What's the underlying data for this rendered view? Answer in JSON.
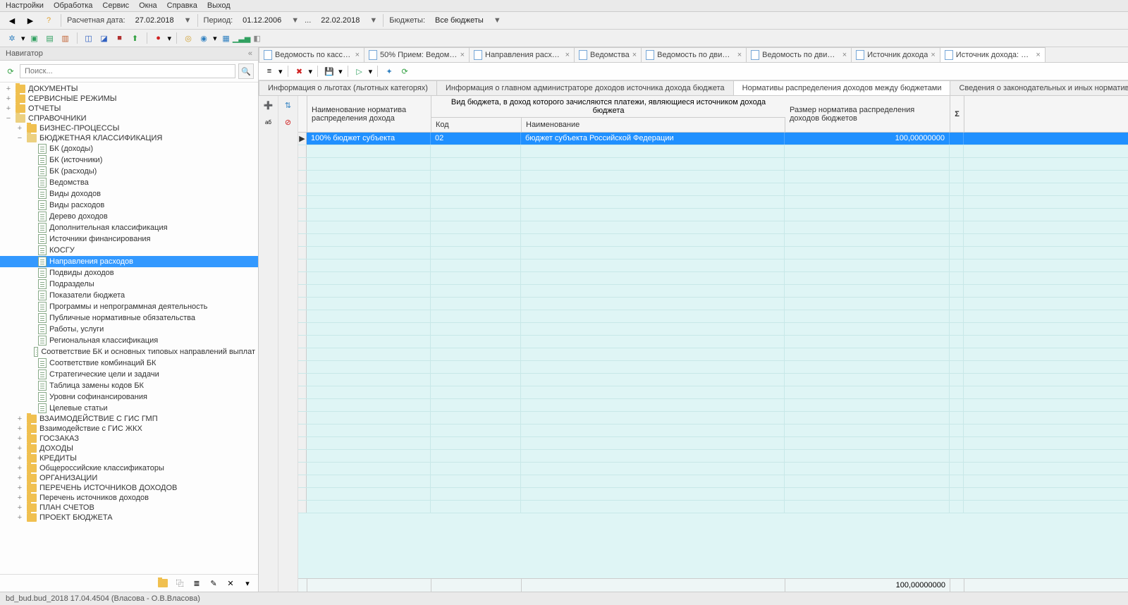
{
  "menu": [
    "Настройки",
    "Обработка",
    "Сервис",
    "Окна",
    "Справка",
    "Выход"
  ],
  "toolbar1": {
    "date_label": "Расчетная дата:",
    "date_value": "27.02.2018",
    "period_label": "Период:",
    "period_from": "01.12.2006",
    "period_to": "22.02.2018",
    "period_sep": "...",
    "budget_label": "Бюджеты:",
    "budget_value": "Все бюджеты"
  },
  "navigator": {
    "title": "Навигатор",
    "collapse": "«",
    "search_placeholder": "Поиск...",
    "tree": [
      {
        "level": 0,
        "type": "folder",
        "open": false,
        "exp": "+",
        "label": "ДОКУМЕНТЫ"
      },
      {
        "level": 0,
        "type": "folder",
        "open": false,
        "exp": "+",
        "label": "СЕРВИСНЫЕ РЕЖИМЫ"
      },
      {
        "level": 0,
        "type": "folder",
        "open": false,
        "exp": "+",
        "label": "ОТЧЕТЫ"
      },
      {
        "level": 0,
        "type": "folder",
        "open": true,
        "exp": "−",
        "label": "СПРАВОЧНИКИ"
      },
      {
        "level": 1,
        "type": "folder",
        "open": false,
        "exp": "+",
        "label": "БИЗНЕС-ПРОЦЕССЫ"
      },
      {
        "level": 1,
        "type": "folder",
        "open": true,
        "exp": "−",
        "label": "БЮДЖЕТНАЯ КЛАССИФИКАЦИЯ"
      },
      {
        "level": 2,
        "type": "doc",
        "label": "БК (доходы)"
      },
      {
        "level": 2,
        "type": "doc",
        "label": "БК (источники)"
      },
      {
        "level": 2,
        "type": "doc",
        "label": "БК (расходы)"
      },
      {
        "level": 2,
        "type": "doc",
        "label": "Ведомства"
      },
      {
        "level": 2,
        "type": "doc",
        "label": "Виды доходов"
      },
      {
        "level": 2,
        "type": "doc",
        "label": "Виды расходов"
      },
      {
        "level": 2,
        "type": "doc",
        "label": "Дерево доходов"
      },
      {
        "level": 2,
        "type": "doc",
        "label": "Дополнительная классификация"
      },
      {
        "level": 2,
        "type": "doc",
        "label": "Источники финансирования"
      },
      {
        "level": 2,
        "type": "doc",
        "label": "КОСГУ"
      },
      {
        "level": 2,
        "type": "doc",
        "label": "Направления расходов",
        "selected": true
      },
      {
        "level": 2,
        "type": "doc",
        "label": "Подвиды доходов"
      },
      {
        "level": 2,
        "type": "doc",
        "label": "Подразделы"
      },
      {
        "level": 2,
        "type": "doc",
        "label": "Показатели бюджета"
      },
      {
        "level": 2,
        "type": "doc",
        "label": "Программы и непрограммная деятельность"
      },
      {
        "level": 2,
        "type": "doc",
        "label": "Публичные нормативные обязательства"
      },
      {
        "level": 2,
        "type": "doc",
        "label": "Работы, услуги"
      },
      {
        "level": 2,
        "type": "doc",
        "label": "Региональная классификация"
      },
      {
        "level": 2,
        "type": "doc",
        "label": "Соответствие БК и основных типовых направлений выплат"
      },
      {
        "level": 2,
        "type": "doc",
        "label": "Соответствие комбинаций БК"
      },
      {
        "level": 2,
        "type": "doc",
        "label": "Стратегические цели и задачи"
      },
      {
        "level": 2,
        "type": "doc",
        "label": "Таблица замены кодов БК"
      },
      {
        "level": 2,
        "type": "doc",
        "label": "Уровни софинансирования"
      },
      {
        "level": 2,
        "type": "doc",
        "label": "Целевые статьи"
      },
      {
        "level": 1,
        "type": "folder",
        "open": false,
        "exp": "+",
        "label": "ВЗАИМОДЕЙСТВИЕ С ГИС ГМП"
      },
      {
        "level": 1,
        "type": "folder",
        "open": false,
        "exp": "+",
        "label": "Взаимодействие с ГИС ЖКХ"
      },
      {
        "level": 1,
        "type": "folder",
        "open": false,
        "exp": "+",
        "label": "ГОСЗАКАЗ"
      },
      {
        "level": 1,
        "type": "folder",
        "open": false,
        "exp": "+",
        "label": "ДОХОДЫ"
      },
      {
        "level": 1,
        "type": "folder",
        "open": false,
        "exp": "+",
        "label": "КРЕДИТЫ"
      },
      {
        "level": 1,
        "type": "folder",
        "open": false,
        "exp": "+",
        "label": "Общероссийские классификаторы"
      },
      {
        "level": 1,
        "type": "folder",
        "open": false,
        "exp": "+",
        "label": "ОРГАНИЗАЦИИ"
      },
      {
        "level": 1,
        "type": "folder",
        "open": false,
        "exp": "+",
        "label": "ПЕРЕЧЕНЬ ИСТОЧНИКОВ ДОХОДОВ"
      },
      {
        "level": 1,
        "type": "folder",
        "open": false,
        "exp": "+",
        "label": "Перечень источников доходов"
      },
      {
        "level": 1,
        "type": "folder",
        "open": false,
        "exp": "+",
        "label": "ПЛАН СЧЕТОВ"
      },
      {
        "level": 1,
        "type": "folder",
        "open": false,
        "exp": "+",
        "label": "ПРОЕКТ БЮДЖЕТА"
      }
    ]
  },
  "doc_tabs": [
    {
      "label": "Ведомость по кассо...",
      "active": false
    },
    {
      "label": "50% Прием: Ведомос...",
      "active": false
    },
    {
      "label": "Направления расхо...",
      "active": false
    },
    {
      "label": "Ведомства",
      "active": false
    },
    {
      "label": "Ведомость по движе...",
      "active": false
    },
    {
      "label": "Ведомость по движе...",
      "active": false
    },
    {
      "label": "Источник дохода",
      "active": false
    },
    {
      "label": "Источник дохода: №...",
      "active": true
    }
  ],
  "sub_tabs": [
    {
      "label": "Информация о льготах (льготных категорях)",
      "active": false
    },
    {
      "label": "Информация о главном администраторе доходов источника дохода бюджета",
      "active": false
    },
    {
      "label": "Нормативы распределения доходов между бюджетами",
      "active": true
    },
    {
      "label": "Сведения о законодательных и иных нормативных правов",
      "active": false
    }
  ],
  "grid": {
    "headers": {
      "col1": "Наименование норматива распределения дохода",
      "group_top": "Вид бюджета, в доход которого зачисляются платежи, являющиеся источником дохода бюджета",
      "col2": "Код",
      "col3": "Наименование",
      "col4": "Размер норматива распределения доходов бюджетов",
      "sigma": "Σ"
    },
    "row": {
      "c1": "100% бюджет субъекта",
      "c2": "02",
      "c3": "бюджет субъекта Российской Федерации",
      "c4": "100,00000000"
    },
    "footer_total": "100,00000000"
  },
  "status": "bd_bud.bud_2018 17.04.4504 (Власова - О.В.Власова)"
}
